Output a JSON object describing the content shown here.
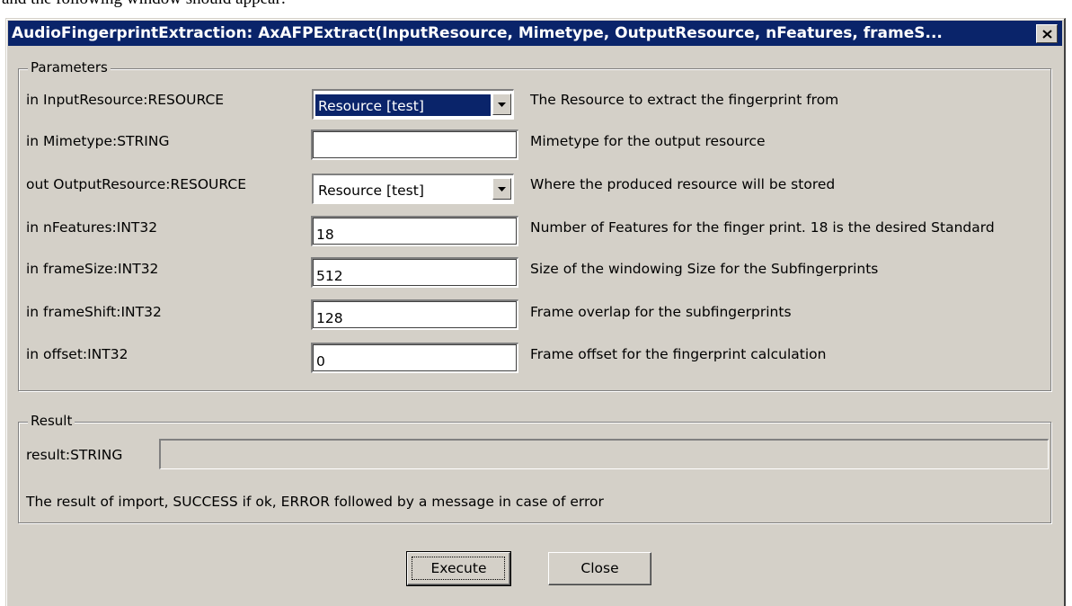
{
  "doc_text": "and the following window should appear:",
  "window": {
    "title": "AudioFingerprintExtraction: AxAFPExtract(InputResource, Mimetype, OutputResource, nFeatures, frameS...",
    "close_icon": "close-icon"
  },
  "parameters": {
    "legend": "Parameters",
    "rows": [
      {
        "label": "in InputResource:RESOURCE",
        "kind": "combo",
        "value": "Resource [test]",
        "selected": true,
        "description": "The Resource to extract the fingerprint from"
      },
      {
        "label": "in Mimetype:STRING",
        "kind": "text",
        "value": "",
        "description": "Mimetype for the output resource"
      },
      {
        "label": "out OutputResource:RESOURCE",
        "kind": "combo",
        "value": "Resource [test]",
        "selected": false,
        "description": "Where the produced resource will be stored"
      },
      {
        "label": "in nFeatures:INT32",
        "kind": "text",
        "value": "18",
        "description": "Number of Features for the finger print. 18 is the desired Standard"
      },
      {
        "label": "in frameSize:INT32",
        "kind": "text",
        "value": "512",
        "description": "Size of the windowing Size for the Subfingerprints"
      },
      {
        "label": "in frameShift:INT32",
        "kind": "text",
        "value": "128",
        "description": "Frame overlap for the subfingerprints"
      },
      {
        "label": "in offset:INT32",
        "kind": "text",
        "value": "0",
        "description": "Frame offset for the fingerprint calculation"
      }
    ]
  },
  "result": {
    "legend": "Result",
    "label": "result:STRING",
    "value": "",
    "description": "The result of import, SUCCESS if ok, ERROR followed by a message in case of error"
  },
  "buttons": {
    "execute_label": "Execute",
    "close_label": "Close"
  },
  "colors": {
    "titlebar": "#0a246a",
    "face": "#d4d0c8",
    "selection": "#0a246a"
  }
}
